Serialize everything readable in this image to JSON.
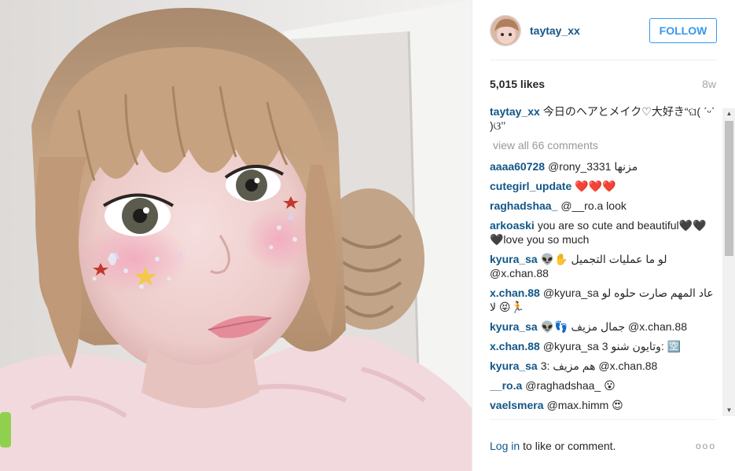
{
  "post": {
    "username": "taytay_xx",
    "follow_label": "FOLLOW",
    "likes": "5,015 likes",
    "age": "8w",
    "caption": "今日のヘアとメイク♡大好きؐ࿶(ˊᵕˋ)࿶؂",
    "caption_display": "今日のヘアとメイク♡大好き“ଘ( ˊᵕˋ )ଓ’’",
    "view_all": "view all 66 comments"
  },
  "comments": [
    {
      "user": "aaaa60728",
      "text": "@rony_3331 مزنها"
    },
    {
      "user": "cutegirl_update",
      "text": "❤️❤️❤️"
    },
    {
      "user": "raghadshaa_",
      "text": "@__ro.a look"
    },
    {
      "user": "arkoaski",
      "text": "you are so cute and beautiful🖤🖤🖤love you so much"
    },
    {
      "user": "kyura_sa",
      "text": "👽✋ لو ما عمليات التجميل @x.chan.88"
    },
    {
      "user": "x.chan.88",
      "text": "@kyura_sa عاد المهم صارت حلوه لو لا 😝🏃"
    },
    {
      "user": "kyura_sa",
      "text": "👽👣 جمال مزيف @x.chan.88"
    },
    {
      "user": "x.chan.88",
      "text": "@kyura_sa وتايون شنو 3: 🈳"
    },
    {
      "user": "kyura_sa",
      "text": "3: هم مزيف @x.chan.88"
    },
    {
      "user": "__ro.a",
      "text": "@raghadshaa_ 😮"
    },
    {
      "user": "vaelsmera",
      "text": "@max.himm 😍"
    }
  ],
  "footer": {
    "login": "Log in",
    "rest": "to like or comment.",
    "more": "ooo"
  },
  "icons": {
    "more": "more-options-icon",
    "scroll_up": "scroll-up-icon",
    "scroll_down": "scroll-down-icon"
  },
  "colors": {
    "link": "#125688",
    "follow": "#3897f0",
    "muted": "#999999"
  }
}
